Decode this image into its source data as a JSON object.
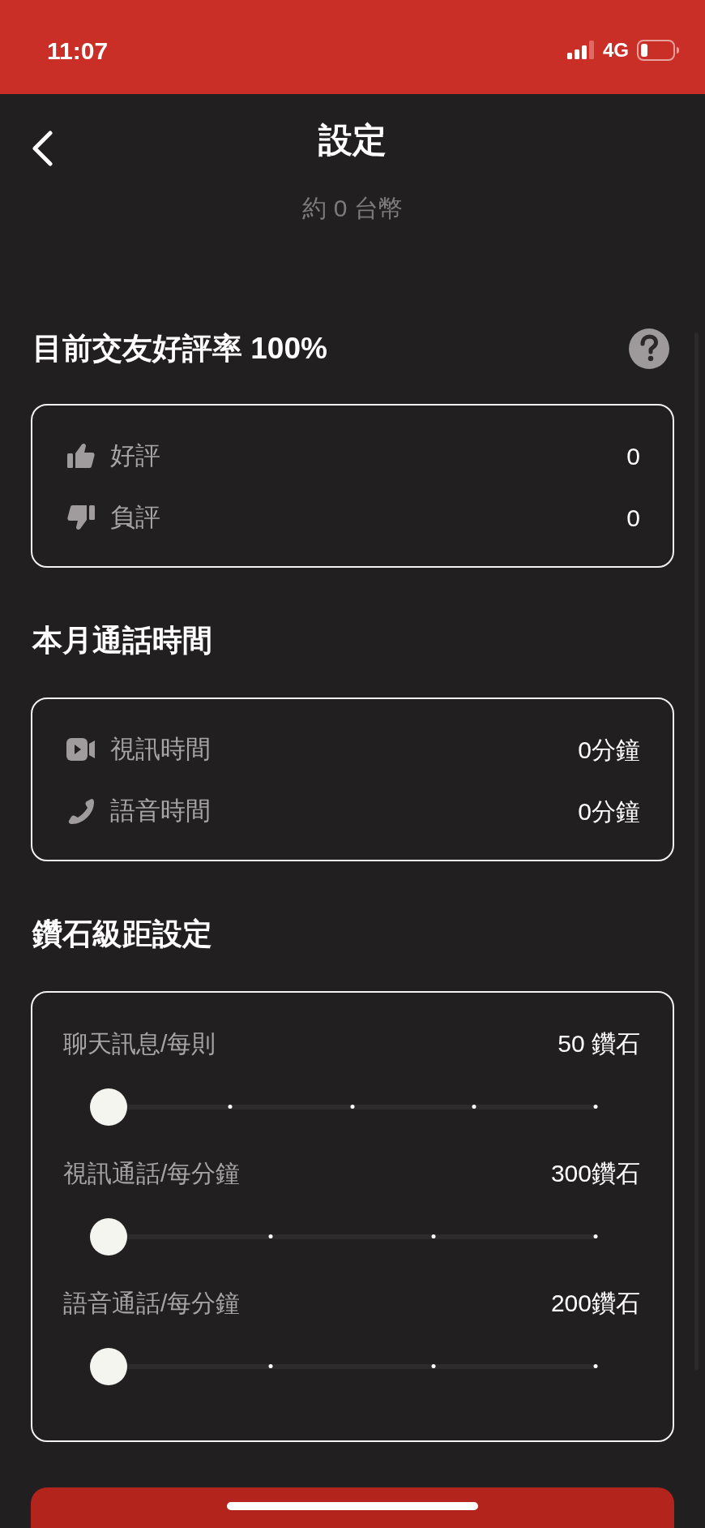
{
  "status_bar": {
    "time": "11:07",
    "network": "4G"
  },
  "header": {
    "title": "設定"
  },
  "balance_note": "約 0 台幣",
  "rating": {
    "title": "目前交友好評率 100%",
    "rows": [
      {
        "kind": "like",
        "label": "好評",
        "value": "0"
      },
      {
        "kind": "dislike",
        "label": "負評",
        "value": "0"
      }
    ]
  },
  "call_time": {
    "title": "本月通話時間",
    "rows": [
      {
        "kind": "video",
        "label": "視訊時間",
        "value": "0分鐘"
      },
      {
        "kind": "voice",
        "label": "語音時間",
        "value": "0分鐘"
      }
    ]
  },
  "diamond_levels": {
    "title": "鑽石級距設定",
    "sliders": [
      {
        "kind": "fine",
        "label": "聊天訊息/每則",
        "value": "50 鑽石",
        "level": 0
      },
      {
        "kind": "coarse",
        "label": "視訊通話/每分鐘",
        "value": "300鑽石",
        "level": 0
      },
      {
        "kind": "coarse",
        "label": "語音通話/每分鐘",
        "value": "200鑽石",
        "level": 0
      }
    ]
  }
}
